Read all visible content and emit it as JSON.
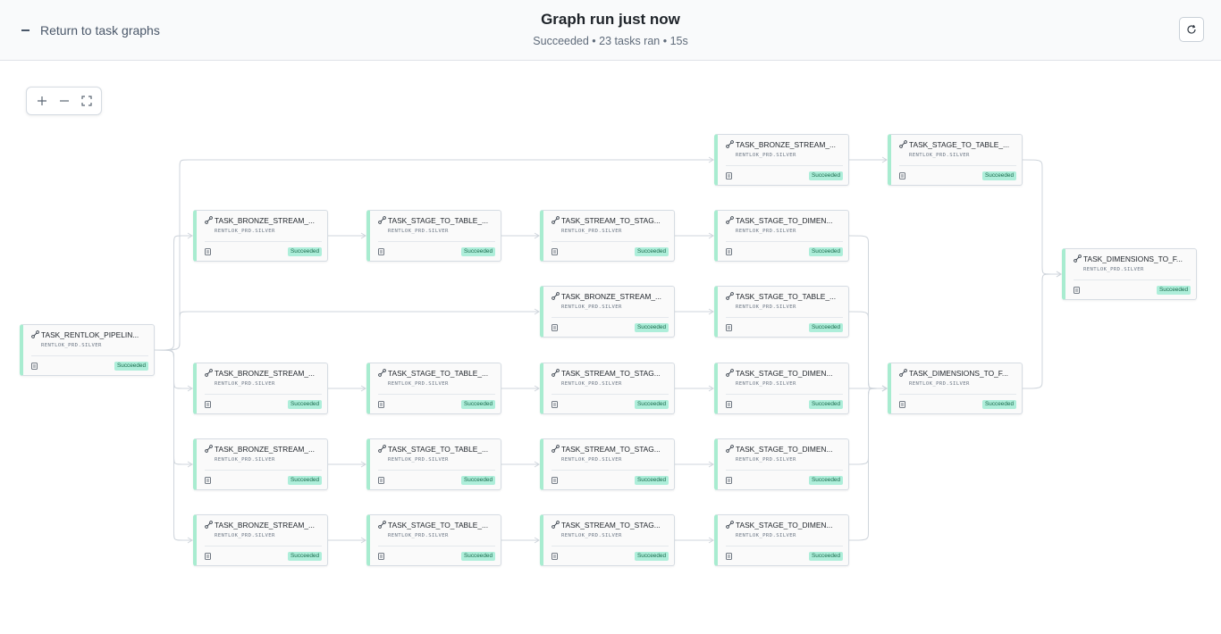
{
  "header": {
    "back_label": "Return to task graphs",
    "title": "Graph run just now",
    "subtitle": "Succeeded • 23 tasks ran • 15s"
  },
  "zoom_controls": [
    "zoom-in",
    "zoom-out",
    "fit-view"
  ],
  "colors": {
    "badge_bg": "#aeeeda",
    "badge_text": "#1a6a4c",
    "node_accent": "#a8ecd0",
    "edge": "#cfd5dc"
  },
  "nodes": [
    {
      "id": "n0",
      "name": "TASK_RENTLOK_PIPELIN...",
      "schema": "RENTLOK_PRD.SILVER",
      "status": "Succeeded"
    },
    {
      "id": "n1",
      "name": "TASK_BRONZE_STREAM_...",
      "schema": "RENTLOK_PRD.SILVER",
      "status": "Succeeded"
    },
    {
      "id": "n2",
      "name": "TASK_STAGE_TO_TABLE_...",
      "schema": "RENTLOK_PRD.SILVER",
      "status": "Succeeded"
    },
    {
      "id": "n3",
      "name": "TASK_BRONZE_STREAM_...",
      "schema": "RENTLOK_PRD.SILVER",
      "status": "Succeeded"
    },
    {
      "id": "n4",
      "name": "TASK_STAGE_TO_TABLE_...",
      "schema": "RENTLOK_PRD.SILVER",
      "status": "Succeeded"
    },
    {
      "id": "n5",
      "name": "TASK_STREAM_TO_STAG...",
      "schema": "RENTLOK_PRD.SILVER",
      "status": "Succeeded"
    },
    {
      "id": "n6",
      "name": "TASK_STAGE_TO_DIMEN...",
      "schema": "RENTLOK_PRD.SILVER",
      "status": "Succeeded"
    },
    {
      "id": "n7",
      "name": "TASK_BRONZE_STREAM_...",
      "schema": "RENTLOK_PRD.SILVER",
      "status": "Succeeded"
    },
    {
      "id": "n8",
      "name": "TASK_STAGE_TO_TABLE_...",
      "schema": "RENTLOK_PRD.SILVER",
      "status": "Succeeded"
    },
    {
      "id": "n9",
      "name": "TASK_BRONZE_STREAM_...",
      "schema": "RENTLOK_PRD.SILVER",
      "status": "Succeeded"
    },
    {
      "id": "n10",
      "name": "TASK_STAGE_TO_TABLE_...",
      "schema": "RENTLOK_PRD.SILVER",
      "status": "Succeeded"
    },
    {
      "id": "n11",
      "name": "TASK_STREAM_TO_STAG...",
      "schema": "RENTLOK_PRD.SILVER",
      "status": "Succeeded"
    },
    {
      "id": "n12",
      "name": "TASK_STAGE_TO_DIMEN...",
      "schema": "RENTLOK_PRD.SILVER",
      "status": "Succeeded"
    },
    {
      "id": "n13",
      "name": "TASK_BRONZE_STREAM_...",
      "schema": "RENTLOK_PRD.SILVER",
      "status": "Succeeded"
    },
    {
      "id": "n14",
      "name": "TASK_STAGE_TO_TABLE_...",
      "schema": "RENTLOK_PRD.SILVER",
      "status": "Succeeded"
    },
    {
      "id": "n15",
      "name": "TASK_STREAM_TO_STAG...",
      "schema": "RENTLOK_PRD.SILVER",
      "status": "Succeeded"
    },
    {
      "id": "n16",
      "name": "TASK_STAGE_TO_DIMEN...",
      "schema": "RENTLOK_PRD.SILVER",
      "status": "Succeeded"
    },
    {
      "id": "n17",
      "name": "TASK_BRONZE_STREAM_...",
      "schema": "RENTLOK_PRD.SILVER",
      "status": "Succeeded"
    },
    {
      "id": "n18",
      "name": "TASK_STAGE_TO_TABLE_...",
      "schema": "RENTLOK_PRD.SILVER",
      "status": "Succeeded"
    },
    {
      "id": "n19",
      "name": "TASK_STREAM_TO_STAG...",
      "schema": "RENTLOK_PRD.SILVER",
      "status": "Succeeded"
    },
    {
      "id": "n20",
      "name": "TASK_STAGE_TO_DIMEN...",
      "schema": "RENTLOK_PRD.SILVER",
      "status": "Succeeded"
    },
    {
      "id": "n21",
      "name": "TASK_DIMENSIONS_TO_F...",
      "schema": "RENTLOK_PRD.SILVER",
      "status": "Succeeded"
    },
    {
      "id": "n22",
      "name": "TASK_DIMENSIONS_TO_F...",
      "schema": "RENTLOK_PRD.SILVER",
      "status": "Succeeded"
    }
  ],
  "edges": [
    [
      "n0",
      "n1"
    ],
    [
      "n0",
      "n3"
    ],
    [
      "n0",
      "n7"
    ],
    [
      "n0",
      "n9"
    ],
    [
      "n0",
      "n13"
    ],
    [
      "n0",
      "n17"
    ],
    [
      "n1",
      "n2"
    ],
    [
      "n3",
      "n4"
    ],
    [
      "n4",
      "n5"
    ],
    [
      "n5",
      "n6"
    ],
    [
      "n7",
      "n8"
    ],
    [
      "n9",
      "n10"
    ],
    [
      "n10",
      "n11"
    ],
    [
      "n11",
      "n12"
    ],
    [
      "n13",
      "n14"
    ],
    [
      "n14",
      "n15"
    ],
    [
      "n15",
      "n16"
    ],
    [
      "n17",
      "n18"
    ],
    [
      "n18",
      "n19"
    ],
    [
      "n19",
      "n20"
    ],
    [
      "n6",
      "n21"
    ],
    [
      "n8",
      "n21"
    ],
    [
      "n12",
      "n21"
    ],
    [
      "n16",
      "n21"
    ],
    [
      "n20",
      "n21"
    ],
    [
      "n2",
      "n22"
    ],
    [
      "n21",
      "n22"
    ]
  ]
}
